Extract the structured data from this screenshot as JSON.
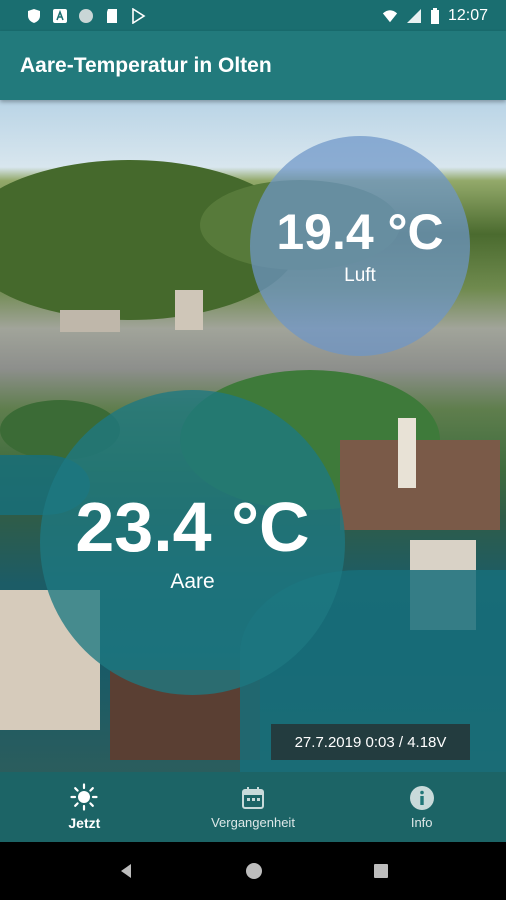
{
  "status_bar": {
    "time": "12:07",
    "icons": [
      "shield-icon",
      "text-icon",
      "circle-icon",
      "sdcard-icon",
      "play-store-icon",
      "wifi-icon",
      "signal-icon",
      "battery-icon"
    ]
  },
  "app_bar": {
    "title": "Aare-Temperatur in Olten"
  },
  "air": {
    "temperature": "19.4 °C",
    "label": "Luft"
  },
  "river": {
    "temperature": "23.4 °C",
    "label": "Aare"
  },
  "measurement": {
    "timestamp": "27.7.2019 0:03 / 4.18V"
  },
  "bottom_nav": {
    "items": [
      {
        "label": "Jetzt",
        "icon": "sun-icon",
        "active": true
      },
      {
        "label": "Vergangenheit",
        "icon": "calendar-icon",
        "active": false
      },
      {
        "label": "Info",
        "icon": "info-icon",
        "active": false
      }
    ]
  },
  "colors": {
    "primary": "#227a7c",
    "status_bar": "#1a6e70",
    "air_bubble": "#6e96c8",
    "river_bubble": "#1e7882"
  }
}
